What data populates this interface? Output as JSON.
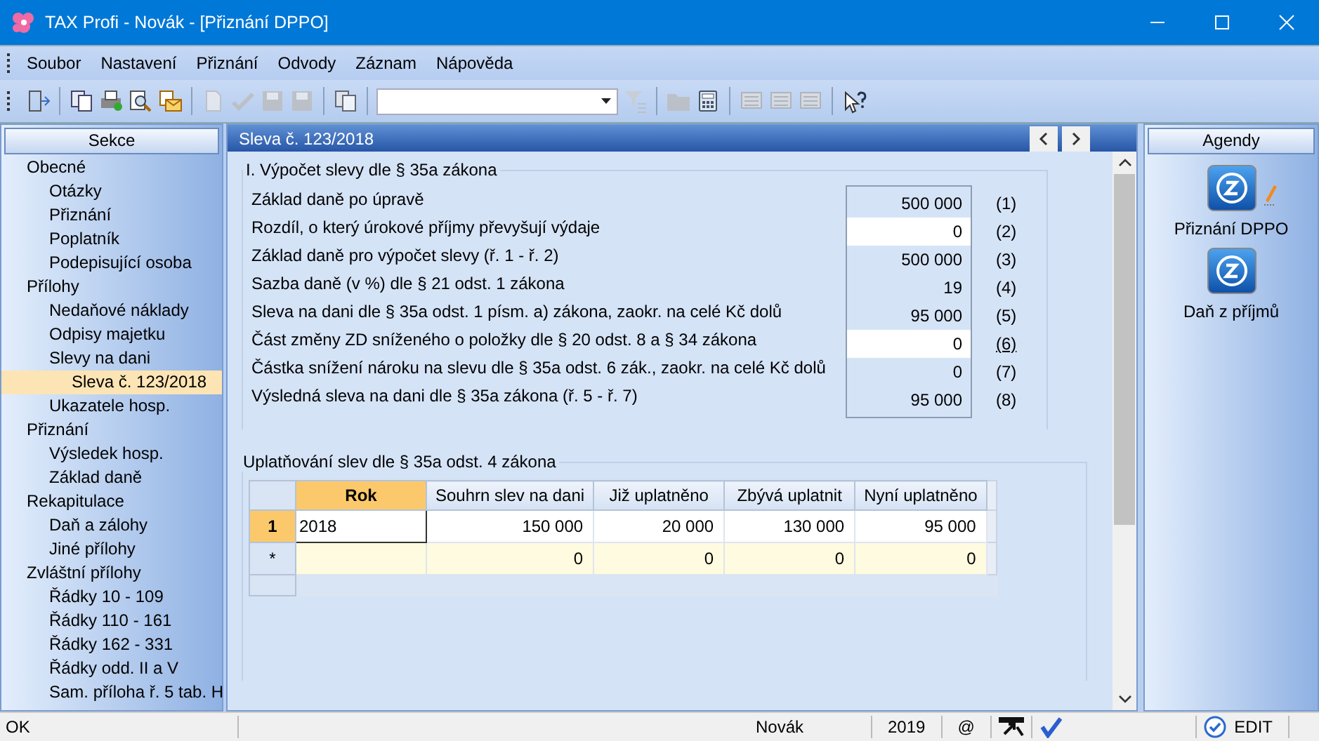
{
  "window": {
    "title": "TAX Profi - Novák - [Přiznání DPPO]"
  },
  "menu": [
    "Soubor",
    "Nastavení",
    "Přiznání",
    "Odvody",
    "Záznam",
    "Nápověda"
  ],
  "toolbar": [
    {
      "kind": "exit",
      "disabled": false
    },
    {
      "kind": "sep"
    },
    {
      "kind": "copy",
      "disabled": false
    },
    {
      "kind": "print",
      "disabled": false
    },
    {
      "kind": "preview",
      "disabled": false
    },
    {
      "kind": "mail",
      "disabled": false
    },
    {
      "kind": "sep"
    },
    {
      "kind": "page",
      "disabled": true
    },
    {
      "kind": "check",
      "disabled": true
    },
    {
      "kind": "save",
      "disabled": true
    },
    {
      "kind": "save",
      "disabled": true
    },
    {
      "kind": "sep"
    },
    {
      "kind": "copy",
      "disabled": true
    },
    {
      "kind": "sep"
    },
    {
      "kind": "combo"
    },
    {
      "kind": "filter",
      "disabled": true
    },
    {
      "kind": "sep"
    },
    {
      "kind": "folder",
      "disabled": true
    },
    {
      "kind": "calc",
      "disabled": false
    },
    {
      "kind": "sep"
    },
    {
      "kind": "list",
      "disabled": true
    },
    {
      "kind": "list",
      "disabled": true
    },
    {
      "kind": "list",
      "disabled": true
    },
    {
      "kind": "sep"
    },
    {
      "kind": "help",
      "disabled": false
    }
  ],
  "sidebar": {
    "title": "Sekce",
    "items": [
      {
        "label": "Obecné",
        "selected": false,
        "children": [
          {
            "label": "Otázky",
            "selected": false
          },
          {
            "label": "Přiznání",
            "selected": false
          },
          {
            "label": "Poplatník",
            "selected": false
          },
          {
            "label": "Podepisující osoba",
            "selected": false
          }
        ]
      },
      {
        "label": "Přílohy",
        "selected": false,
        "children": [
          {
            "label": "Nedaňové náklady",
            "selected": false
          },
          {
            "label": "Odpisy majetku",
            "selected": false
          },
          {
            "label": "Slevy na dani",
            "selected": false,
            "children": [
              {
                "label": "Sleva č. 123/2018",
                "selected": true
              }
            ]
          },
          {
            "label": "Ukazatele hosp.",
            "selected": false
          }
        ]
      },
      {
        "label": "Přiznání",
        "selected": false,
        "children": [
          {
            "label": "Výsledek hosp.",
            "selected": false
          },
          {
            "label": "Základ daně",
            "selected": false
          }
        ]
      },
      {
        "label": "Rekapitulace",
        "selected": false,
        "children": [
          {
            "label": "Daň a zálohy",
            "selected": false
          },
          {
            "label": "Jiné přílohy",
            "selected": false
          }
        ]
      },
      {
        "label": "Zvláštní přílohy",
        "selected": false,
        "children": [
          {
            "label": "Řádky 10 - 109",
            "selected": false
          },
          {
            "label": "Řádky 110 - 161",
            "selected": false
          },
          {
            "label": "Řádky 162 - 331",
            "selected": false
          },
          {
            "label": "Řádky odd. II a V",
            "selected": false
          },
          {
            "label": "Sam. příloha ř. 5 tab. H",
            "selected": false
          }
        ]
      }
    ]
  },
  "content": {
    "title": "Sleva č. 123/2018",
    "section1": {
      "title": "I. Výpočet slevy dle § 35a zákona",
      "rows": [
        {
          "label": "Základ daně po úpravě",
          "value": "500 000",
          "number": "(1)",
          "editable": false,
          "link": false
        },
        {
          "label": "Rozdíl, o který úrokové příjmy převyšují výdaje",
          "value": "0",
          "number": "(2)",
          "editable": true,
          "link": false
        },
        {
          "label": "Základ daně pro výpočet slevy (ř. 1 - ř. 2)",
          "value": "500 000",
          "number": "(3)",
          "editable": false,
          "link": false
        },
        {
          "label": "Sazba daně (v %) dle § 21 odst. 1 zákona",
          "value": "19",
          "number": "(4)",
          "editable": false,
          "link": false
        },
        {
          "label": "Sleva na dani dle § 35a odst. 1 písm. a) zákona, zaokr. na celé Kč dolů",
          "value": "95 000",
          "number": "(5)",
          "editable": false,
          "link": false
        },
        {
          "label": "Část změny ZD sníženého o položky dle § 20 odst. 8 a § 34 zákona",
          "value": "0",
          "number": "(6)",
          "editable": true,
          "link": true
        },
        {
          "label": "Částka snížení nároku na slevu dle § 35a odst. 6 zák., zaokr. na celé Kč dolů",
          "value": "0",
          "number": "(7)",
          "editable": false,
          "link": false
        },
        {
          "label": "Výsledná sleva na dani dle § 35a zákona (ř. 5 - ř. 7)",
          "value": "95 000",
          "number": "(8)",
          "editable": false,
          "link": false
        }
      ]
    },
    "section2": {
      "title": "Uplatňování slev dle § 35a odst. 4 zákona",
      "columns": [
        {
          "label": "Rok",
          "selected": true
        },
        {
          "label": "Souhrn slev na dani",
          "selected": false
        },
        {
          "label": "Již uplatněno",
          "selected": false
        },
        {
          "label": "Zbývá uplatnit",
          "selected": false
        },
        {
          "label": "Nyní uplatněno",
          "selected": false
        }
      ],
      "rows": [
        {
          "header": "1",
          "selected": true,
          "kind": "data",
          "cells": [
            "2018",
            "150 000",
            "20 000",
            "130 000",
            "95 000"
          ]
        },
        {
          "header": "*",
          "selected": false,
          "kind": "new",
          "cells": [
            "",
            "0",
            "0",
            "0",
            "0"
          ]
        }
      ]
    }
  },
  "agendas": {
    "title": "Agendy",
    "items": [
      {
        "label": "Přiznání DPPO",
        "editing": true
      },
      {
        "label": "Daň z příjmů",
        "editing": false
      }
    ]
  },
  "status_bar": {
    "state": "OK",
    "user": "Novák",
    "year": "2019",
    "at": "@",
    "mode": "EDIT"
  }
}
